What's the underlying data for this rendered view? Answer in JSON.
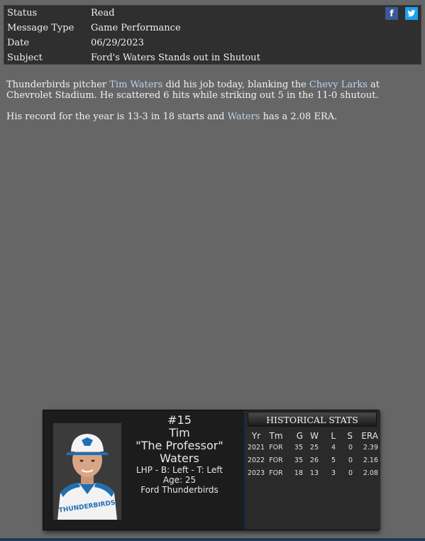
{
  "header": {
    "rows": [
      {
        "label": "Status",
        "value": "Read"
      },
      {
        "label": "Message Type",
        "value": "Game Performance"
      },
      {
        "label": "Date",
        "value": "06/29/2023"
      },
      {
        "label": "Subject",
        "value": "Ford's Waters Stands out in Shutout"
      }
    ],
    "share": {
      "facebook_icon": "f",
      "twitter_icon": "twitter-bird",
      "facebook_color": "#3b5998",
      "twitter_color": "#1da1f2"
    }
  },
  "article": {
    "p1_a": "Thunderbirds pitcher ",
    "p1_link1": "Tim Waters",
    "p1_b": " did his job today, blanking the ",
    "p1_link2": "Chevy Larks",
    "p1_c": " at Chevrolet Stadium. He scattered 6 hits while striking out 5 in the 11-0 shutout.",
    "p2_a": "His record for the year is 13-3 in 18 starts and ",
    "p2_link": "Waters",
    "p2_b": " has a 2.08 ERA."
  },
  "player": {
    "number": "#15",
    "first": "Tim",
    "nickname": "\"The Professor\"",
    "last": "Waters",
    "hands": "LHP - B: Left - T: Left",
    "age": "Age: 25",
    "team": "Ford Thunderbirds",
    "jersey_text": "THUNDERBIRDS"
  },
  "stats": {
    "title": "HISTORICAL STATS",
    "columns": [
      "Yr",
      "Tm",
      "G",
      "W",
      "L",
      "S",
      "ERA"
    ],
    "rows": [
      [
        "2021",
        "FOR",
        "35",
        "25",
        "4",
        "0",
        "2.39"
      ],
      [
        "2022",
        "FOR",
        "35",
        "26",
        "5",
        "0",
        "2.16"
      ],
      [
        "2023",
        "FOR",
        "18",
        "13",
        "3",
        "0",
        "2.08"
      ]
    ]
  }
}
